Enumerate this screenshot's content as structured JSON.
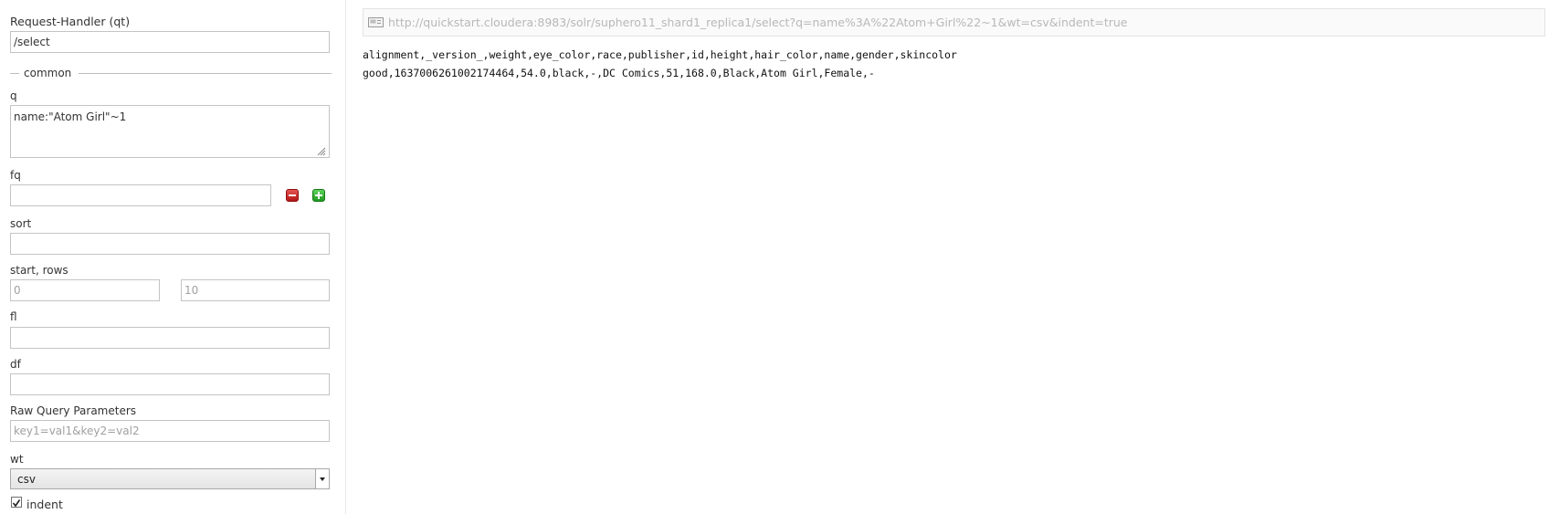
{
  "form": {
    "request_handler": {
      "label": "Request-Handler (qt)",
      "value": "/select"
    },
    "common_legend": "common",
    "q": {
      "label": "q",
      "value": "name:\"Atom Girl\"~1"
    },
    "fq": {
      "label": "fq",
      "value": ""
    },
    "sort": {
      "label": "sort",
      "value": ""
    },
    "start_rows": {
      "label": "start, rows",
      "start_placeholder": "0",
      "rows_placeholder": "10"
    },
    "fl": {
      "label": "fl",
      "value": ""
    },
    "df": {
      "label": "df",
      "value": ""
    },
    "raw": {
      "label": "Raw Query Parameters",
      "placeholder": "key1=val1&key2=val2"
    },
    "wt": {
      "label": "wt",
      "selected": "csv"
    },
    "indent": {
      "label": "indent",
      "checked": true
    }
  },
  "result": {
    "url": "http://quickstart.cloudera:8983/solr/suphero11_shard1_replica1/select?q=name%3A%22Atom+Girl%22~1&wt=csv&indent=true",
    "header_line": "alignment,_version_,weight,eye_color,race,publisher,id,height,hair_color,name,gender,skincolor",
    "rows": [
      "good,1637006261002174464,54.0,black,-,DC Comics,51,168.0,Black,Atom Girl,Female,-"
    ]
  },
  "icons": {
    "remove": "minus-icon",
    "add": "plus-icon",
    "url": "url-icon"
  },
  "colors": {
    "remove_button": "#c92020",
    "add_button": "#2eaa2e",
    "url_text": "#b8b8b8"
  }
}
